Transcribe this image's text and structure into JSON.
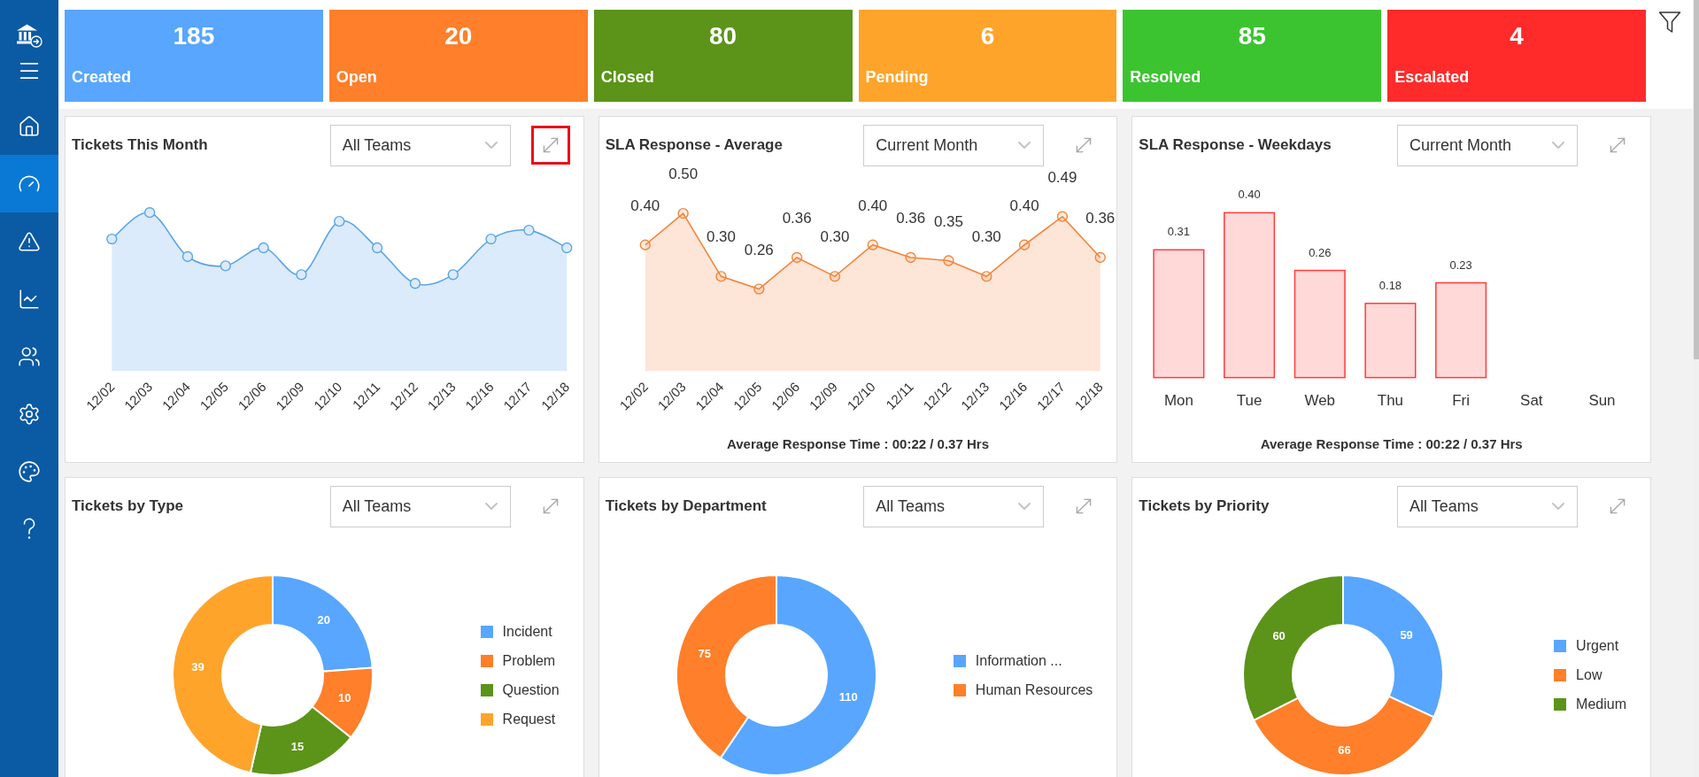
{
  "sidebar": {
    "items": [
      {
        "kind": "home",
        "selected": false
      },
      {
        "kind": "dashboard",
        "selected": true
      },
      {
        "kind": "alerts",
        "selected": false
      },
      {
        "kind": "reports",
        "selected": false
      },
      {
        "kind": "users",
        "selected": false
      },
      {
        "kind": "settings",
        "selected": false
      },
      {
        "kind": "themes",
        "selected": false
      },
      {
        "kind": "help",
        "selected": false
      }
    ]
  },
  "summary_cards": [
    {
      "count": "185",
      "label": "Created",
      "color": "#58a6ff"
    },
    {
      "count": "20",
      "label": "Open",
      "color": "#ff7f2a"
    },
    {
      "count": "80",
      "label": "Closed",
      "color": "#5b9419"
    },
    {
      "count": "6",
      "label": "Pending",
      "color": "#ffa42b"
    },
    {
      "count": "85",
      "label": "Resolved",
      "color": "#3bc430"
    },
    {
      "count": "4",
      "label": "Escalated",
      "color": "#ff2b2b"
    }
  ],
  "panels": [
    {
      "kind": "trend",
      "title": "Tickets This Month",
      "filter": {
        "value": "All Teams"
      },
      "expand": {
        "highlighted": true
      },
      "x_labels": [
        "12/02",
        "12/03",
        "12/04",
        "12/05",
        "12/06",
        "12/09",
        "12/10",
        "12/11",
        "12/12",
        "12/13",
        "12/16",
        "12/17",
        "12/18"
      ]
    },
    {
      "kind": "chart",
      "title": "SLA Response - Average",
      "filter": {
        "value": "Current Month"
      },
      "expand": {
        "highlighted": false
      },
      "chart_data": {
        "type": "area",
        "categories": [
          "12/02",
          "12/03",
          "12/04",
          "12/05",
          "12/06",
          "12/09",
          "12/10",
          "12/11",
          "12/12",
          "12/13",
          "12/16",
          "12/17",
          "12/18"
        ],
        "series": [
          {
            "color": "#f4843a",
            "values": [
              0.4,
              0.5,
              0.3,
              0.26,
              0.36,
              0.3,
              0.4,
              0.36,
              0.35,
              0.3,
              0.4,
              0.49,
              0.36
            ],
            "value_labels": [
              "0.40",
              "0.50",
              "0.30",
              "0.26",
              "0.36",
              "0.30",
              "0.40",
              "0.36",
              "0.35",
              "0.30",
              "0.40",
              "0.49",
              "0.36"
            ]
          }
        ],
        "data_labels": true
      },
      "footer": "Average Response Time : 00:22 / 0.37 Hrs"
    },
    {
      "kind": "chart",
      "title": "SLA Response - Weekdays",
      "filter": {
        "value": "Current Month"
      },
      "expand": {
        "highlighted": false
      },
      "chart_data": {
        "type": "bar",
        "categories": [
          "Mon",
          "Tue",
          "Web",
          "Thu",
          "Fri",
          "Sat",
          "Sun"
        ],
        "series": [
          {
            "color": "#ff3b3b",
            "values": [
              0.31,
              0.4,
              0.26,
              0.18,
              0.23,
              null,
              null
            ],
            "value_labels": [
              "0.31",
              "0.40",
              "0.26",
              "0.18",
              "0.23",
              null,
              null
            ]
          }
        ],
        "data_labels": true
      },
      "footer": "Average Response Time : 00:22 / 0.37 Hrs"
    },
    {
      "kind": "chart",
      "title": "Tickets by Type",
      "filter": {
        "value": "All Teams"
      },
      "expand": {
        "highlighted": false
      },
      "chart_data": {
        "type": "donut",
        "categories": [
          "Incident",
          "Problem",
          "Question",
          "Request"
        ],
        "values": [
          20,
          10,
          15,
          39
        ],
        "colors": [
          "#58a6ff",
          "#ff7f2a",
          "#5b9419",
          "#ffa42b"
        ],
        "data_labels": true,
        "legend": "right"
      }
    },
    {
      "kind": "chart",
      "title": "Tickets by Department",
      "filter": {
        "value": "All Teams"
      },
      "expand": {
        "highlighted": false
      },
      "chart_data": {
        "type": "donut",
        "categories": [
          "Information ...",
          "Human Resources"
        ],
        "values": [
          110,
          75
        ],
        "colors": [
          "#58a6ff",
          "#ff7f2a"
        ],
        "data_labels": true,
        "legend": "right"
      }
    },
    {
      "kind": "chart",
      "title": "Tickets by Priority",
      "filter": {
        "value": "All Teams"
      },
      "expand": {
        "highlighted": false
      },
      "chart_data": {
        "type": "donut",
        "categories": [
          "Urgent",
          "Low",
          "Medium"
        ],
        "values": [
          59,
          66,
          60
        ],
        "colors": [
          "#58a6ff",
          "#ff7f2a",
          "#5b9419"
        ],
        "data_labels": true,
        "legend": "right"
      }
    }
  ]
}
